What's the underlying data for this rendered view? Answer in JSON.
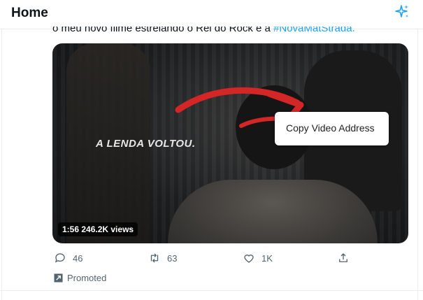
{
  "header": {
    "title": "Home",
    "sparkle_icon": "sparkle-icon"
  },
  "tweet": {
    "text_prefix": "o meu novo filme estreiando o Rei do Rock é a ",
    "hashtag": "#NovaMatStrada.",
    "video": {
      "overlay_text": "A LENDA VOLTOU.",
      "duration_views": "1:56  246.2K views"
    },
    "context_menu": {
      "item": "Copy Video Address"
    },
    "actions": {
      "replies": "46",
      "retweets": "63",
      "likes": "1K"
    },
    "promoted": "Promoted"
  },
  "colors": {
    "accent": "#1da1f2",
    "arrow": "#d32626",
    "muted": "#536471"
  }
}
